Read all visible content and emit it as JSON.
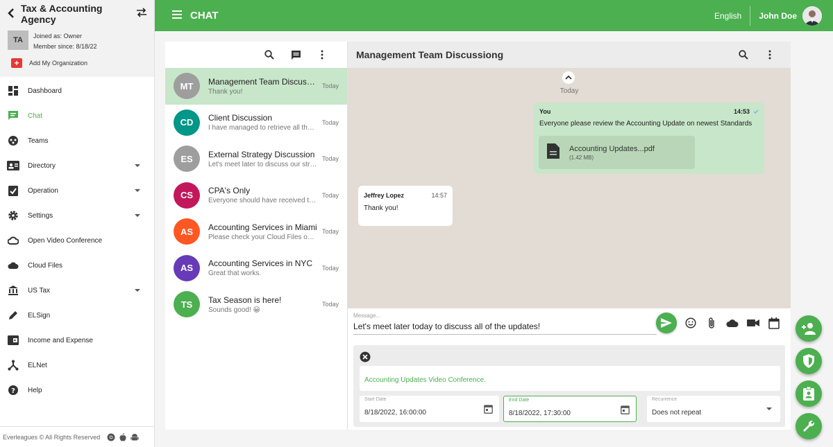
{
  "org": {
    "name": "Tax & Accounting Agency",
    "initials": "TA",
    "joined": "Joined as: Owner",
    "member_since": "Member since: 8/18/22",
    "add_org": "Add My Organization"
  },
  "nav": {
    "dashboard": "Dashboard",
    "chat": "Chat",
    "teams": "Teams",
    "directory": "Directory",
    "operation": "Operation",
    "settings": "Settings",
    "video": "Open Video Conference",
    "cloud": "Cloud Files",
    "ustax": "US Tax",
    "elsign": "ELSign",
    "income": "Income and Expense",
    "elnet": "ELNet",
    "help": "Help"
  },
  "footer": {
    "copyright": "Everleagues © All Rights Reserved"
  },
  "topbar": {
    "title": "CHAT",
    "language": "English",
    "user": "John Doe"
  },
  "chats": [
    {
      "initials": "MT",
      "color": "#9e9e9e",
      "name": "Management Team Discussiong",
      "preview": "Thank you!",
      "time": "Today"
    },
    {
      "initials": "CD",
      "color": "#009688",
      "name": "Client Discussion",
      "preview": "I have managed to retrieve all the documents",
      "time": "Today"
    },
    {
      "initials": "ES",
      "color": "#9e9e9e",
      "name": "External Strategy Discussion",
      "preview": "Let's meet later to discuss our strategy",
      "time": "Today"
    },
    {
      "initials": "CS",
      "color": "#c2185b",
      "name": "CPA's Only",
      "preview": "Everyone should have received the update",
      "time": "Today"
    },
    {
      "initials": "AS",
      "color": "#ff5722",
      "name": "Accounting Services in Miami",
      "preview": "Please check your Cloud Files on the portal",
      "time": "Today"
    },
    {
      "initials": "AS",
      "color": "#673ab7",
      "name": "Accounting Services in NYC",
      "preview": "Great that works.",
      "time": "Today"
    },
    {
      "initials": "TS",
      "color": "#4caf50",
      "name": "Tax Season is here!",
      "preview": "Sounds good! 😀",
      "time": "Today"
    }
  ],
  "conversation": {
    "title": "Management Team Discussiong",
    "day": "Today",
    "outgoing": {
      "sender": "You",
      "time": "14:53",
      "text": "Everyone please review the Accounting Update on newest Standards",
      "file_name": "Accounting Updates...pdf",
      "file_size": "(1.42 MB)"
    },
    "incoming": {
      "sender": "Jeffrey Lopez",
      "time": "14:57",
      "text": "Thank you!"
    }
  },
  "composer": {
    "label": "Message...",
    "value": "Let's meet later today to discuss all of the updates!"
  },
  "video_conf": {
    "title": "Accounting Updates Video Conference.",
    "start_label": "Start Date",
    "start_value": "8/18/2022, 16:00:00",
    "end_label": "End Date",
    "end_value": "8/18/2022, 17:30:00",
    "recurrence_label": "Recurrence",
    "recurrence_value": "Does not repeat"
  },
  "colors": {
    "accent": "#4caf50",
    "bubble_out": "#c8e6c9",
    "chat_bg": "#e2dcd5"
  }
}
